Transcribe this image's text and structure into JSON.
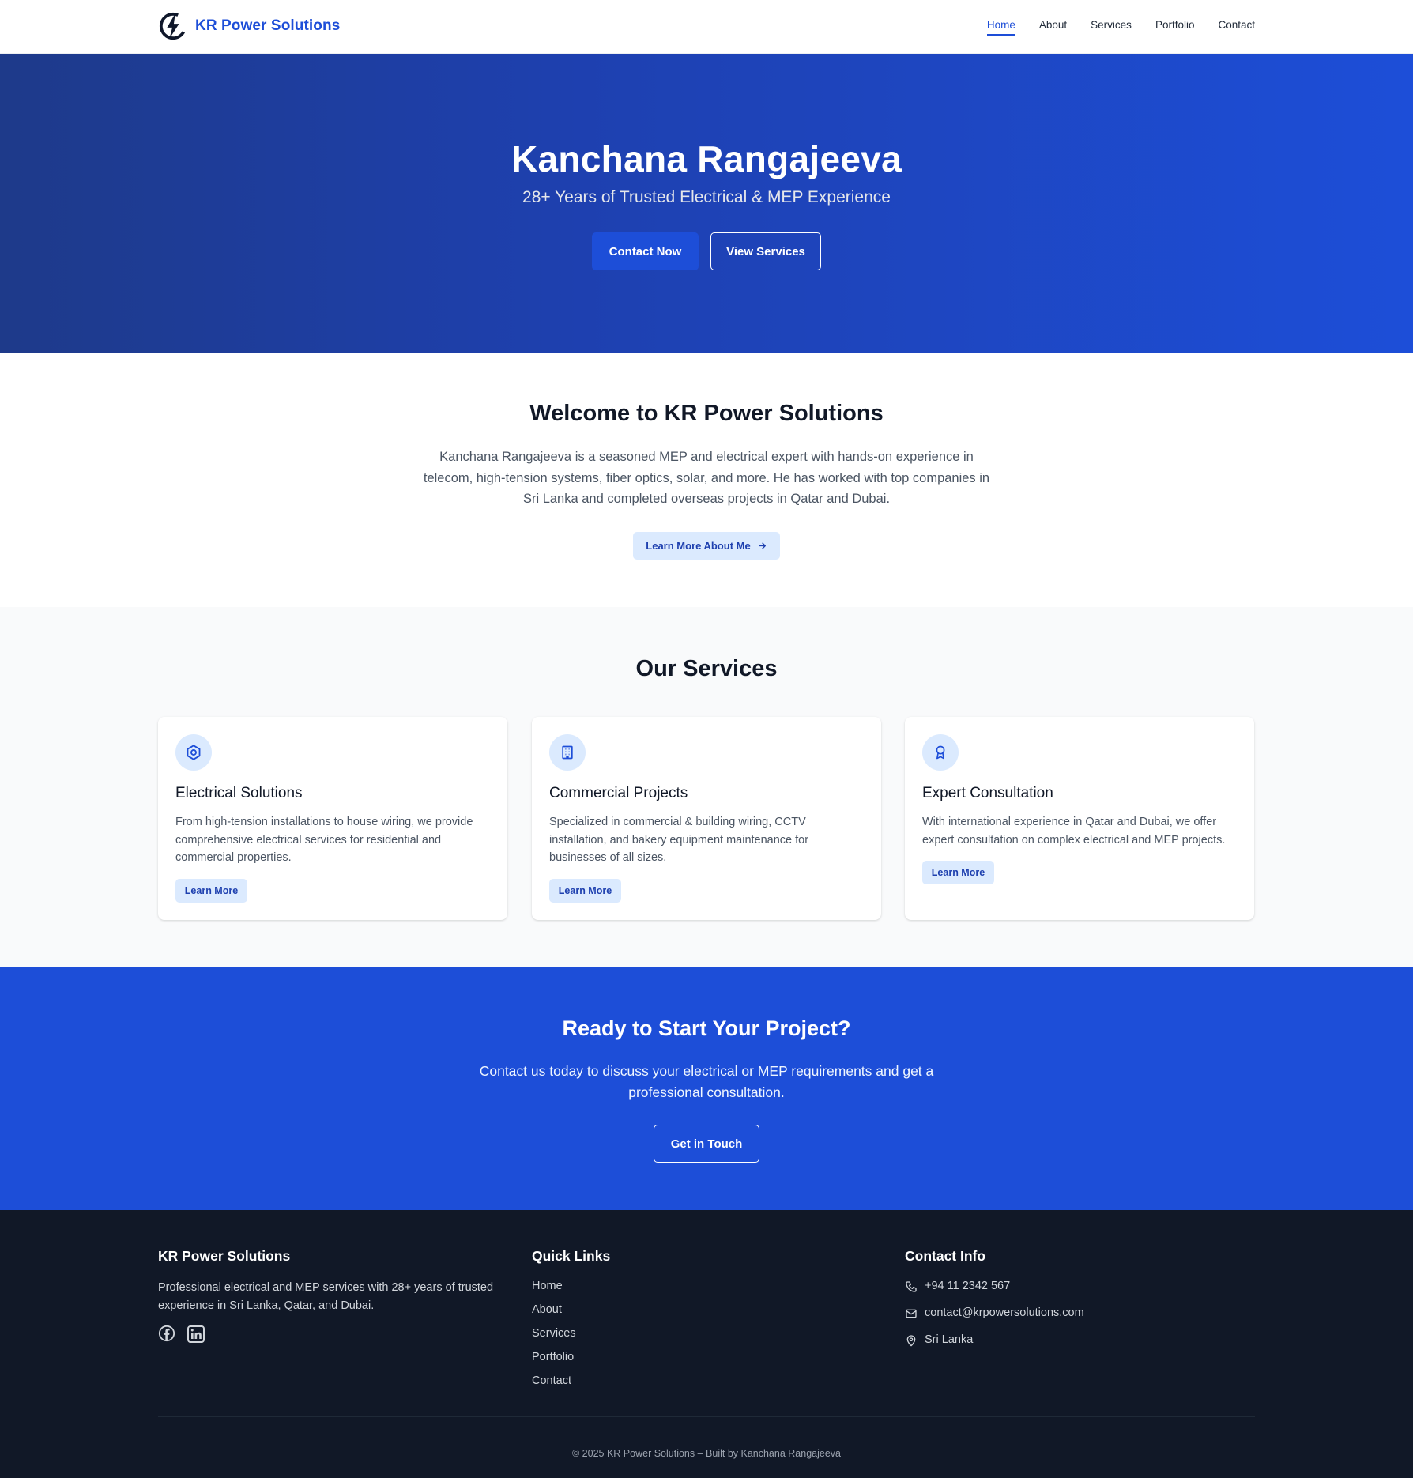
{
  "header": {
    "brand": "KR Power Solutions",
    "brand_icon": "lightning-bolt-icon",
    "nav": [
      {
        "label": "Home",
        "active": true
      },
      {
        "label": "About",
        "active": false
      },
      {
        "label": "Services",
        "active": false
      },
      {
        "label": "Portfolio",
        "active": false
      },
      {
        "label": "Contact",
        "active": false
      }
    ]
  },
  "hero": {
    "title": "Kanchana Rangajeeva",
    "subtitle": "28+ Years of Trusted Electrical & MEP Experience",
    "primary_button": "Contact Now",
    "secondary_button": "View Services"
  },
  "welcome": {
    "title": "Welcome to KR Power Solutions",
    "description": "Kanchana Rangajeeva is a seasoned MEP and electrical expert with hands-on experience in telecom, high-tension systems, fiber optics, solar, and more. He has worked with top companies in Sri Lanka and completed overseas projects in Qatar and Dubai.",
    "button": "Learn More About Me"
  },
  "services": {
    "title": "Our Services",
    "cards": [
      {
        "icon": "hexagon-gear-icon",
        "title": "Electrical Solutions",
        "text": "From high-tension installations to house wiring, we provide comprehensive electrical services for residential and commercial properties.",
        "button": "Learn More"
      },
      {
        "icon": "building-icon",
        "title": "Commercial Projects",
        "text": "Specialized in commercial & building wiring, CCTV installation, and bakery equipment maintenance for businesses of all sizes.",
        "button": "Learn More"
      },
      {
        "icon": "award-icon",
        "title": "Expert Consultation",
        "text": "With international experience in Qatar and Dubai, we offer expert consultation on complex electrical and MEP projects.",
        "button": "Learn More"
      }
    ]
  },
  "cta": {
    "title": "Ready to Start Your Project?",
    "text": "Contact us today to discuss your electrical or MEP requirements and get a professional consultation.",
    "button": "Get in Touch"
  },
  "footer": {
    "brand": "KR Power Solutions",
    "about": "Professional electrical and MEP services with 28+ years of trusted experience in Sri Lanka, Qatar, and Dubai.",
    "quick_links_title": "Quick Links",
    "quick_links": [
      "Home",
      "About",
      "Services",
      "Portfolio",
      "Contact"
    ],
    "contact_title": "Contact Info",
    "phone": "+94 11 2342 567",
    "email": "contact@krpowersolutions.com",
    "location": "Sri Lanka",
    "copyright": "© 2025 KR Power Solutions – Built by Kanchana Rangajeeva"
  },
  "colors": {
    "primary": "#1d4ed8",
    "hero_dark": "#1e3a8a",
    "footer_bg": "#111827",
    "soft_button": "#dbeafe"
  }
}
